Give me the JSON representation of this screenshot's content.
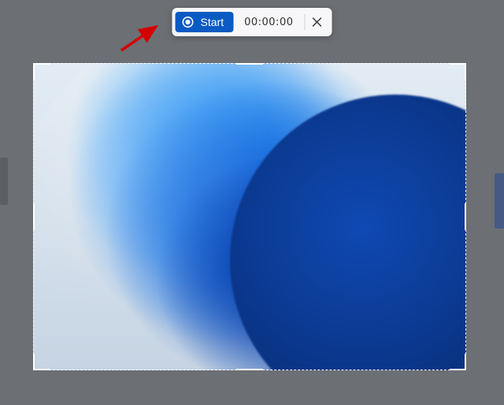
{
  "toolbar": {
    "start_label": "Start",
    "timer": "00:00:00"
  },
  "colors": {
    "accent": "#0a5ac4",
    "annotation": "#d40000"
  }
}
